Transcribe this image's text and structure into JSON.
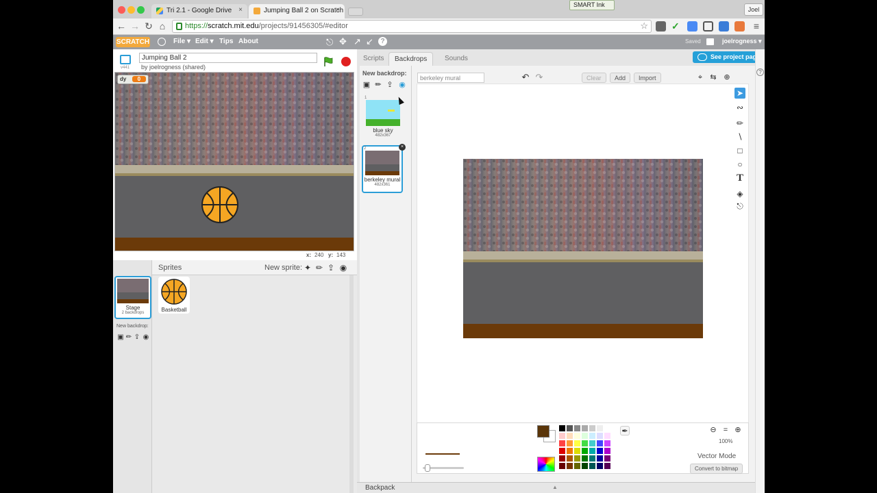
{
  "browser": {
    "tabs": [
      {
        "title": "Tri 2.1 - Google Drive",
        "close": "×"
      },
      {
        "title": "Jumping Ball 2 on Scratch",
        "close": "×"
      }
    ],
    "smart_ink": "SMART Ink",
    "user": "Joel",
    "url_scheme": "https://",
    "url_host": "scratch.mit.edu",
    "url_path": "/projects/91456305/#editor"
  },
  "scratch_menu": {
    "logo": "SCRATCH",
    "items": [
      "File ▾",
      "Edit ▾",
      "Tips",
      "About"
    ],
    "saved": "Saved",
    "username": "joelrogness ▾"
  },
  "stage_header": {
    "version": "v441",
    "project_title": "Jumping Ball 2",
    "byline": "by joelrogness (shared)"
  },
  "stage": {
    "watcher_label": "dy",
    "watcher_value": "0",
    "coord_x_label": "x:",
    "coord_x": "240",
    "coord_y_label": "y:",
    "coord_y": "143"
  },
  "sprites": {
    "header": "Sprites",
    "new_sprite": "New sprite:",
    "stage_thumb_label": "Stage",
    "stage_thumb_sub": "2 backdrops",
    "new_backdrop": "New backdrop:",
    "items": [
      {
        "label": "Basketball"
      }
    ]
  },
  "editor": {
    "tabs": [
      "Scripts",
      "Backdrops",
      "Sounds"
    ],
    "see_project": "See project page",
    "new_backdrop": "New backdrop:",
    "backdrops": [
      {
        "index": "1",
        "name": "blue sky",
        "size": "482x367"
      },
      {
        "index": "2",
        "name": "berkeley mural",
        "size": "482x361"
      }
    ],
    "costume_name": "berkeley mural",
    "buttons": {
      "clear": "Clear",
      "add": "Add",
      "import": "Import"
    },
    "zoom": "100%",
    "mode": "Vector Mode",
    "convert": "Convert to bitmap",
    "backpack": "Backpack"
  },
  "colors": {
    "accent": "#25a0d8",
    "scratch_bar": "#9c9ea2",
    "ground": "#6b3a09",
    "basketball": "#f5a623",
    "selected_fill": "#5a3509"
  }
}
